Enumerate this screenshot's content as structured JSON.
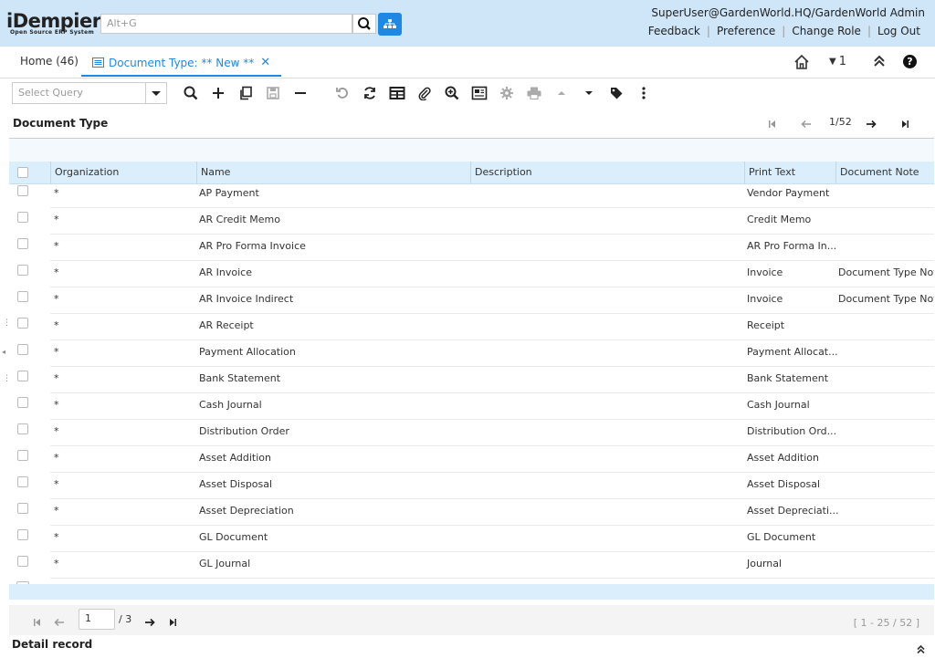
{
  "header": {
    "logo": "iDempiere",
    "logo_sub": "Open Source ERP System",
    "search_placeholder": "Alt+G",
    "user": "SuperUser@GardenWorld.HQ/GardenWorld Admin",
    "links": [
      "Feedback",
      "Preference",
      "Change Role",
      "Log Out"
    ]
  },
  "tabs": {
    "home": "Home (46)",
    "active": "Document Type: ** New **"
  },
  "window_toolbar": {
    "count": "1"
  },
  "toolbar": {
    "select_query": "Select Query"
  },
  "title": "Document Type",
  "record_nav": {
    "position": "1/52"
  },
  "grid": {
    "columns": [
      "Organization",
      "Name",
      "Description",
      "Print Text",
      "Document Note"
    ],
    "rows": [
      {
        "org": "*",
        "name": "AP Payment",
        "desc": "",
        "print": "Vendor Payment",
        "note": ""
      },
      {
        "org": "*",
        "name": "AR Credit Memo",
        "desc": "",
        "print": "Credit Memo",
        "note": ""
      },
      {
        "org": "*",
        "name": "AR Pro Forma Invoice",
        "desc": "",
        "print": "AR Pro Forma In...",
        "note": ""
      },
      {
        "org": "*",
        "name": "AR Invoice",
        "desc": "",
        "print": "Invoice",
        "note": "Document Type Not"
      },
      {
        "org": "*",
        "name": "AR Invoice Indirect",
        "desc": "",
        "print": "Invoice",
        "note": "Document Type Not"
      },
      {
        "org": "*",
        "name": "AR Receipt",
        "desc": "",
        "print": "Receipt",
        "note": ""
      },
      {
        "org": "*",
        "name": "Payment Allocation",
        "desc": "",
        "print": "Payment Allocat...",
        "note": ""
      },
      {
        "org": "*",
        "name": "Bank Statement",
        "desc": "",
        "print": "Bank Statement",
        "note": ""
      },
      {
        "org": "*",
        "name": "Cash Journal",
        "desc": "",
        "print": "Cash Journal",
        "note": ""
      },
      {
        "org": "*",
        "name": "Distribution Order",
        "desc": "",
        "print": "Distribution Ord...",
        "note": ""
      },
      {
        "org": "*",
        "name": "Asset Addition",
        "desc": "",
        "print": "Asset Addition",
        "note": ""
      },
      {
        "org": "*",
        "name": "Asset Disposal",
        "desc": "",
        "print": "Asset Disposal",
        "note": ""
      },
      {
        "org": "*",
        "name": "Asset Depreciation",
        "desc": "",
        "print": "Asset Depreciati...",
        "note": ""
      },
      {
        "org": "*",
        "name": "GL Document",
        "desc": "",
        "print": "GL Document",
        "note": ""
      },
      {
        "org": "*",
        "name": "GL Journal",
        "desc": "",
        "print": "Journal",
        "note": ""
      }
    ]
  },
  "paging": {
    "page": "1",
    "total_pages": "/ 3",
    "range": "[ 1 - 25 / 52 ]"
  },
  "detail_label": "Detail record",
  "colors": {
    "accent": "#1e88e5",
    "header_bg": "#cfe6f9",
    "grid_header": "#daeefc"
  }
}
